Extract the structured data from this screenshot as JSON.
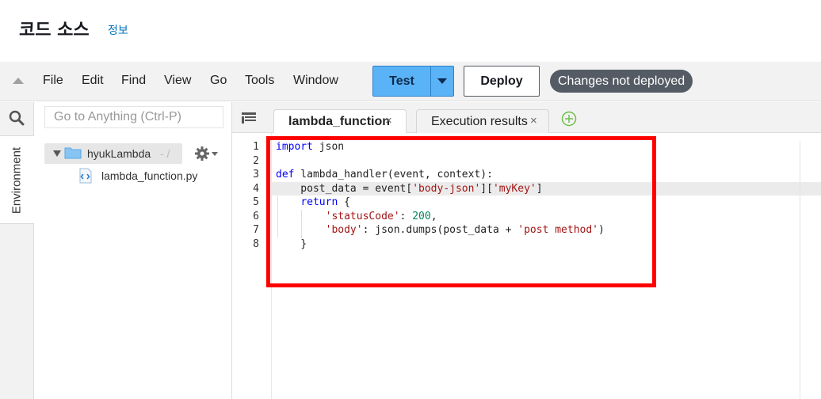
{
  "header": {
    "title": "코드 소스",
    "info_link": "정보"
  },
  "menu": [
    "File",
    "Edit",
    "Find",
    "View",
    "Go",
    "Tools",
    "Window"
  ],
  "toolbar": {
    "test_label": "Test",
    "deploy_label": "Deploy",
    "status_badge": "Changes not deployed"
  },
  "sidebar": {
    "environment_tab": "Environment",
    "goto_placeholder": "Go to Anything (Ctrl-P)"
  },
  "file_tree": {
    "root_label": "hyukLambda",
    "root_suffix": "- /",
    "file_label": "lambda_function.py"
  },
  "tabs": [
    {
      "label": "lambda_function",
      "active": true,
      "close": "×"
    },
    {
      "label": "Execution results",
      "active": false,
      "close": "×"
    }
  ],
  "code": {
    "line_numbers": [
      "1",
      "2",
      "3",
      "4",
      "5",
      "6",
      "7",
      "8"
    ],
    "lines": [
      "import json",
      "",
      "def lambda_handler(event, context):",
      "    post_data = event['body-json']['myKey']",
      "    return {",
      "        'statusCode': 200,",
      "        'body': json.dumps(post_data + 'post method')",
      "    }"
    ],
    "active_line": 4
  },
  "colors": {
    "test_button": "#5ab2f7",
    "status_badge": "#545b64",
    "highlight_box": "#ff0000",
    "info_link": "#0073bb"
  }
}
